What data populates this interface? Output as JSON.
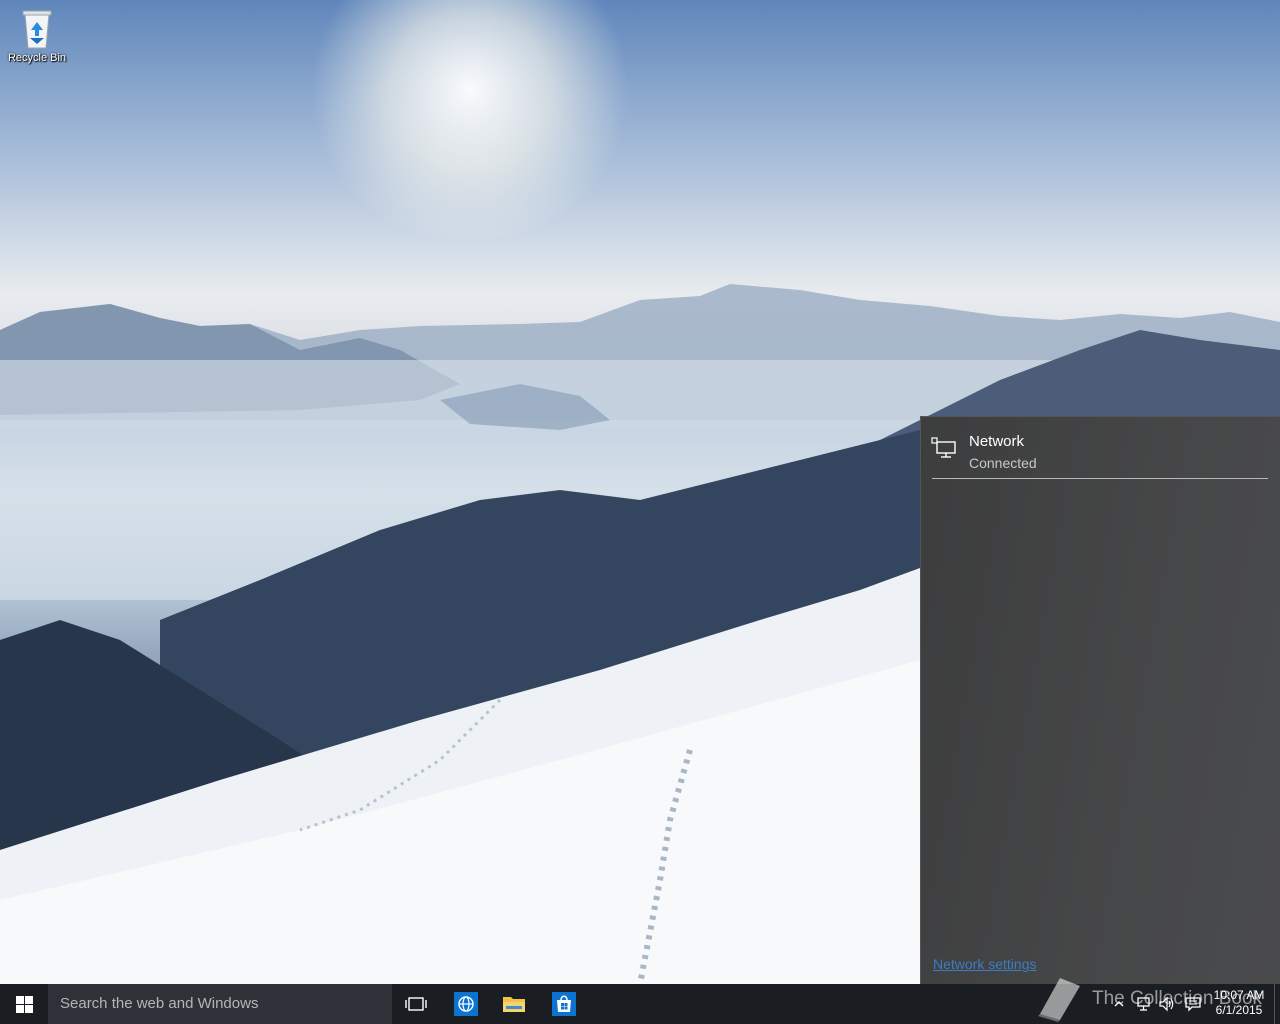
{
  "desktop": {
    "icons": [
      {
        "label": "Recycle Bin",
        "icon": "recycle-bin-icon"
      }
    ]
  },
  "network_flyout": {
    "network_name": "Network",
    "network_status": "Connected",
    "settings_link": "Network settings",
    "icon": "wired-network-icon"
  },
  "taskbar": {
    "search_placeholder": "Search the web and Windows",
    "pinned": [
      {
        "name": "Task View",
        "icon": "task-view-icon"
      },
      {
        "name": "Project Spartan",
        "icon": "spartan-browser-icon"
      },
      {
        "name": "File Explorer",
        "icon": "file-explorer-icon"
      },
      {
        "name": "Store",
        "icon": "store-icon"
      }
    ],
    "tray": {
      "time": "10:07 AM",
      "date": "6/1/2015",
      "icons": [
        "chevron-up-icon",
        "network-icon",
        "volume-icon",
        "action-center-icon"
      ]
    }
  },
  "watermark": {
    "text": "The Collection Book"
  },
  "colors": {
    "taskbar": "#1a1d22",
    "search_box": "#2e3138",
    "flyout": "#3e3e3e",
    "link": "#3d7cc4",
    "accent": "#0a74d0"
  }
}
